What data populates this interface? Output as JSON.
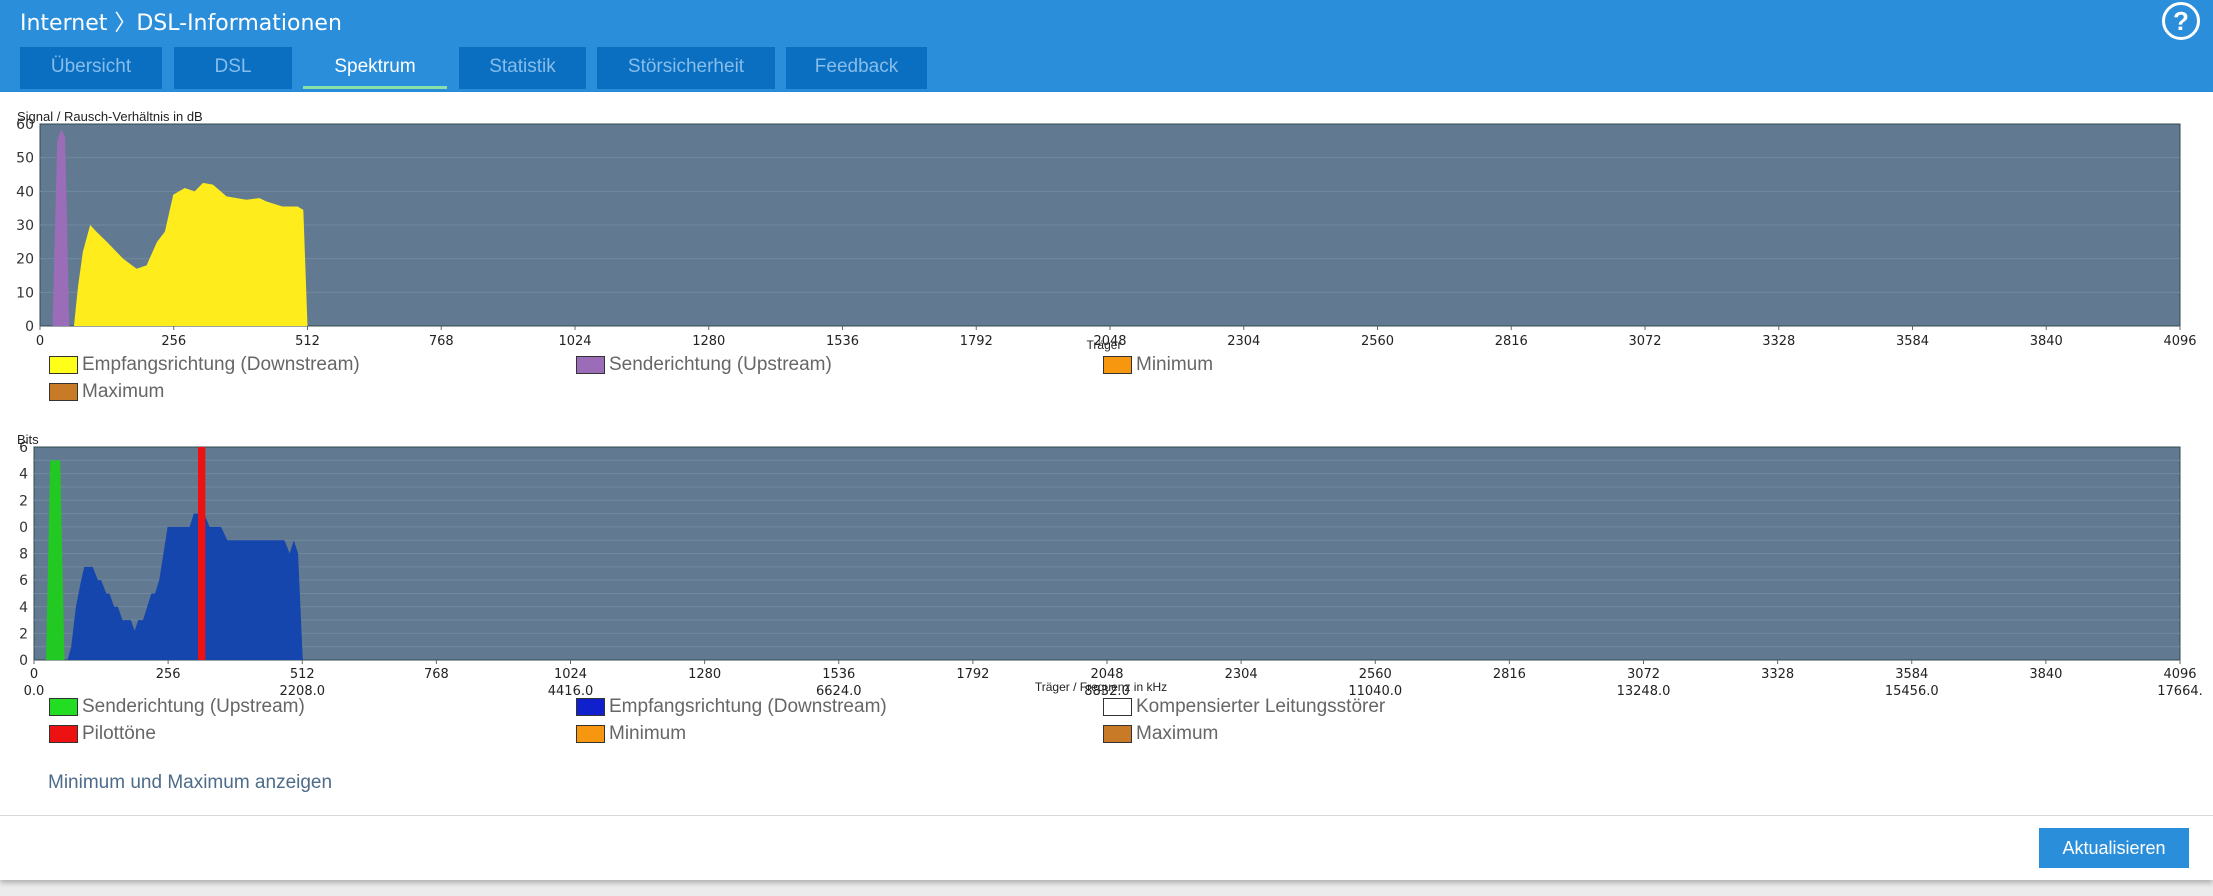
{
  "header": {
    "title": "Internet 〉DSL-Informationen",
    "help_label": "?"
  },
  "tabs": [
    {
      "label": "Übersicht",
      "active": false
    },
    {
      "label": "DSL",
      "active": false
    },
    {
      "label": "Spektrum",
      "active": true
    },
    {
      "label": "Statistik",
      "active": false
    },
    {
      "label": "Störsicherheit",
      "active": false
    },
    {
      "label": "Feedback",
      "active": false
    }
  ],
  "chart_data": [
    {
      "type": "area",
      "title": "Signal / Rausch-Verhältnis in dB",
      "xlabel": "Träger",
      "ylabel": "Signal / Rausch-Verhältnis in dB",
      "xlim": [
        0,
        4096
      ],
      "ylim": [
        0,
        60
      ],
      "xticks": [
        "0",
        "256",
        "512",
        "768",
        "1024",
        "1280",
        "1536",
        "1792",
        "2048",
        "2304",
        "2560",
        "2816",
        "3072",
        "3328",
        "3584",
        "3840",
        "4096"
      ],
      "yticks": [
        "0",
        "10",
        "20",
        "30",
        "40",
        "50",
        "60"
      ],
      "grid": true,
      "series": [
        {
          "name": "Empfangsrichtung (Downstream)",
          "color": "#ffec1c",
          "points": [
            [
              65,
              0
            ],
            [
              73,
              12
            ],
            [
              82,
              22
            ],
            [
              96,
              30
            ],
            [
              108,
              28
            ],
            [
              128,
              25
            ],
            [
              159,
              20
            ],
            [
              185,
              17
            ],
            [
              204,
              18
            ],
            [
              224,
              25
            ],
            [
              239,
              28
            ],
            [
              255,
              39
            ],
            [
              277,
              41
            ],
            [
              296,
              40
            ],
            [
              312,
              42.5
            ],
            [
              331,
              42
            ],
            [
              357,
              38.5
            ],
            [
              395,
              37.5
            ],
            [
              420,
              38
            ],
            [
              433,
              37
            ],
            [
              464,
              35.5
            ],
            [
              493,
              35.5
            ],
            [
              504,
              34.5
            ],
            [
              512,
              0
            ]
          ]
        },
        {
          "name": "Senderichtung (Upstream)",
          "color": "#9b6db8",
          "points": [
            [
              24,
              0
            ],
            [
              33,
              55
            ],
            [
              41,
              58.5
            ],
            [
              48,
              56
            ],
            [
              56,
              0
            ]
          ]
        },
        {
          "name": "Minimum",
          "color": "#f7960f",
          "points": []
        },
        {
          "name": "Maximum",
          "color": "#c97a26",
          "points": []
        }
      ]
    },
    {
      "type": "area",
      "title": "Bits",
      "xlabel": "Träger / Frequenz in kHz",
      "ylabel": "Bits",
      "xlim": [
        0,
        4096
      ],
      "ylim": [
        0,
        16
      ],
      "xticks": [
        "0",
        "256",
        "512",
        "768",
        "1024",
        "1280",
        "1536",
        "1792",
        "2048",
        "2304",
        "2560",
        "2816",
        "3072",
        "3328",
        "3584",
        "3840",
        "4096"
      ],
      "xticks_khz": [
        "0.0",
        "2208.0",
        "4416.0",
        "6624.0",
        "8832.0",
        "11040.0",
        "13248.0",
        "15456.0",
        "17664."
      ],
      "yticks": [
        "0",
        "2",
        "4",
        "6",
        "8",
        "0",
        "2",
        "4",
        "6"
      ],
      "grid": true,
      "series": [
        {
          "name": "Senderichtung (Upstream)",
          "color": "#22c922",
          "points": [
            [
              23,
              0
            ],
            [
              31,
              15
            ],
            [
              50,
              15
            ],
            [
              58,
              0
            ]
          ]
        },
        {
          "name": "Empfangsrichtung (Downstream)",
          "color": "#1446ae",
          "points": [
            [
              64,
              0
            ],
            [
              71,
              1
            ],
            [
              80,
              4
            ],
            [
              90,
              6
            ],
            [
              96,
              7
            ],
            [
              112,
              7
            ],
            [
              122,
              6
            ],
            [
              128,
              6
            ],
            [
              138,
              5
            ],
            [
              144,
              5
            ],
            [
              153,
              4
            ],
            [
              160,
              4
            ],
            [
              169,
              3
            ],
            [
              185,
              3
            ],
            [
              192,
              2.2
            ],
            [
              199,
              3
            ],
            [
              208,
              3
            ],
            [
              224,
              5
            ],
            [
              231,
              5
            ],
            [
              239,
              6
            ],
            [
              255,
              10
            ],
            [
              297,
              10
            ],
            [
              305,
              11
            ],
            [
              325,
              11
            ],
            [
              335,
              10
            ],
            [
              357,
              10
            ],
            [
              369,
              9
            ],
            [
              478,
              9
            ],
            [
              488,
              8
            ],
            [
              496,
              9
            ],
            [
              504,
              8
            ],
            [
              513,
              0
            ]
          ]
        },
        {
          "name": "Kompensierter Leitungsstörer",
          "color": "#ffffff",
          "points": []
        },
        {
          "name": "Pilottöne",
          "color": "#ee1111",
          "bar": [
            313,
            327
          ]
        },
        {
          "name": "Minimum",
          "color": "#f7960f",
          "points": []
        },
        {
          "name": "Maximum",
          "color": "#c97a26",
          "points": []
        }
      ]
    }
  ],
  "legend1": [
    {
      "label": "Empfangsrichtung (Downstream)",
      "color": "#ffff1a"
    },
    {
      "label": "Senderichtung (Upstream)",
      "color": "#9b6db8"
    },
    {
      "label": "Minimum",
      "color": "#f7960f"
    },
    {
      "label": "Maximum",
      "color": "#c97a26"
    }
  ],
  "legend2": [
    {
      "label": "Senderichtung (Upstream)",
      "color": "#22dd22"
    },
    {
      "label": "Empfangsrichtung (Downstream)",
      "color": "#1020cc"
    },
    {
      "label": "Kompensierter Leitungsstörer",
      "color": "#ffffff"
    },
    {
      "label": "Pilottöne",
      "color": "#ee1111"
    },
    {
      "label": "Minimum",
      "color": "#f7960f"
    },
    {
      "label": "Maximum",
      "color": "#c97a26"
    }
  ],
  "link_minmax": "Minimum und Maximum anzeigen",
  "refresh_button": "Aktualisieren"
}
